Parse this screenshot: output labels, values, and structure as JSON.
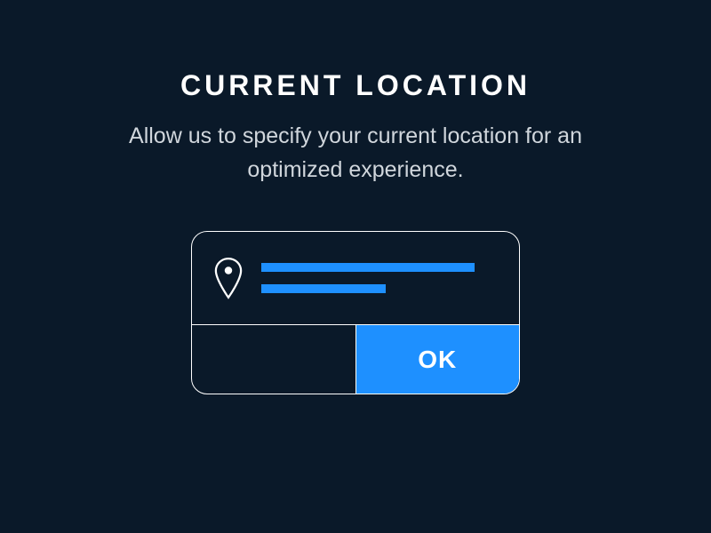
{
  "header": {
    "title": "CURRENT LOCATION",
    "description": "Allow us to specify your current location for an optimized experience."
  },
  "prompt": {
    "icon": "location-pin-icon",
    "ok_label": "OK"
  },
  "colors": {
    "background": "#0a1929",
    "accent": "#1e90ff",
    "text": "#ffffff"
  }
}
